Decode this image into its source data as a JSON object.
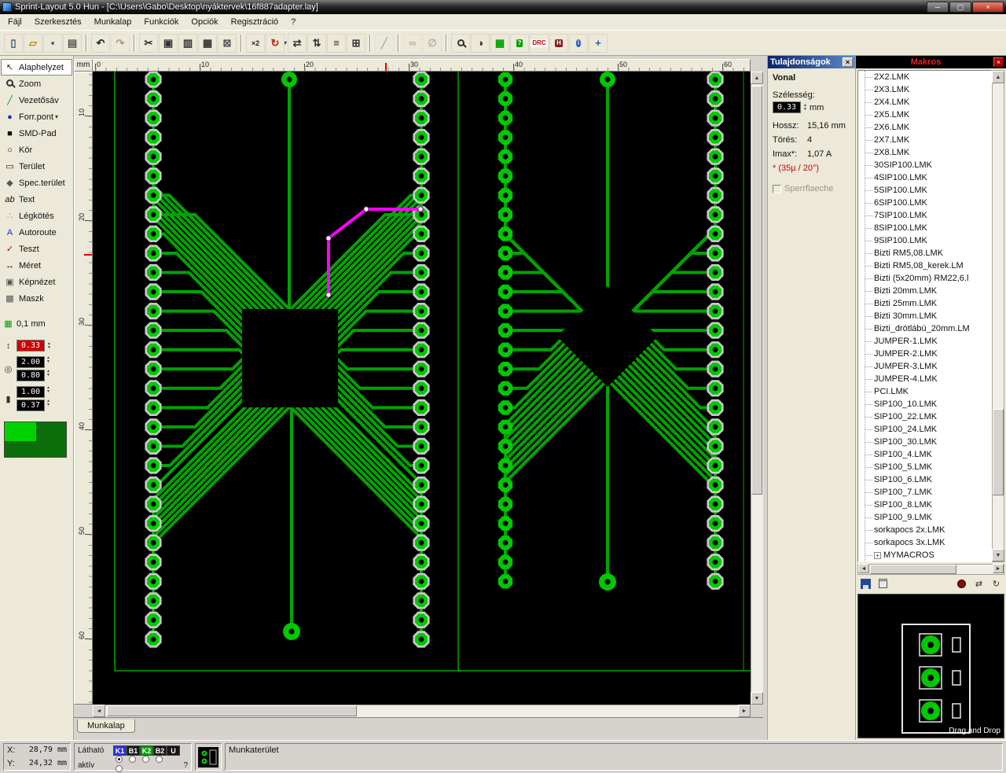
{
  "colors": {
    "trace": "#00a400",
    "pad": "#00c800",
    "silver": "#c8c8c8",
    "selection": "#ff00ff",
    "board_bg": "#000000",
    "value_red": "#cf0000",
    "macro_title_red": "#ee2222"
  },
  "titlebar": {
    "title": "Sprint-Layout 5.0 Hun      - [C:\\Users\\Gabo\\Desktop\\nyáktervek\\16f887adapter.lay]"
  },
  "menu": {
    "items": [
      "Fájl",
      "Szerkesztés",
      "Munkalap",
      "Funkciók",
      "Opciók",
      "Regisztráció",
      "?"
    ]
  },
  "toolbar": {
    "buttons": [
      {
        "name": "new"
      },
      {
        "name": "open"
      },
      {
        "name": "save"
      },
      {
        "name": "print"
      },
      {
        "sep": true
      },
      {
        "name": "undo"
      },
      {
        "name": "redo",
        "disabled": true
      },
      {
        "sep": true
      },
      {
        "name": "cut"
      },
      {
        "name": "copy"
      },
      {
        "name": "paste"
      },
      {
        "name": "duplicate"
      },
      {
        "name": "delete"
      },
      {
        "sep": true
      },
      {
        "name": "scale",
        "text": "×2"
      },
      {
        "name": "rotate",
        "dropdown": true
      },
      {
        "name": "mirror-horizontal"
      },
      {
        "name": "mirror-vertical"
      },
      {
        "name": "align"
      },
      {
        "name": "snap-grid"
      },
      {
        "sep": true
      },
      {
        "name": "solder-side",
        "disabled": true
      },
      {
        "sep": true
      },
      {
        "name": "link",
        "disabled": true
      },
      {
        "name": "unlink",
        "disabled": true
      },
      {
        "sep": true
      },
      {
        "name": "zoom"
      },
      {
        "name": "photo-view"
      },
      {
        "name": "layer-grid"
      },
      {
        "name": "test",
        "text": "?"
      },
      {
        "name": "drc",
        "text": "DRC"
      },
      {
        "name": "hpgl",
        "text": "H"
      },
      {
        "name": "info",
        "text": "i"
      },
      {
        "name": "capture"
      }
    ]
  },
  "tools": {
    "items": [
      {
        "label": "Alaphelyzet",
        "icon": "cursor",
        "active": true
      },
      {
        "label": "Zoom",
        "icon": "magnifier"
      },
      {
        "label": "Vezetősáv",
        "icon": "track"
      },
      {
        "label": "Forr.pont",
        "icon": "solder-pad",
        "dropdown": true
      },
      {
        "label": "SMD-Pad",
        "icon": "smd-pad"
      },
      {
        "label": "Kör",
        "icon": "circle"
      },
      {
        "label": "Terület",
        "icon": "area"
      },
      {
        "label": "Spec.terület",
        "icon": "special-area"
      },
      {
        "label": "Text",
        "icon": "text"
      },
      {
        "label": "Légkötés",
        "icon": "ratsnest"
      },
      {
        "label": "Autoroute",
        "icon": "autoroute"
      },
      {
        "label": "Teszt",
        "icon": "test-probe"
      },
      {
        "label": "Méret",
        "icon": "measure"
      },
      {
        "label": "Képnézet",
        "icon": "photo-view"
      },
      {
        "label": "Maszk",
        "icon": "mask"
      }
    ],
    "grid_label": "0,1 mm",
    "track_width": "0.33",
    "pad_diameter": "2.00",
    "pad_drill": "0.80",
    "smd_width": "1.00",
    "smd_height": "0.37"
  },
  "rulers": {
    "unit": "mm",
    "x_labels": [
      "0",
      "10",
      "20",
      "30",
      "40",
      "50",
      "60"
    ],
    "y_labels": [
      "10",
      "20",
      "30",
      "40",
      "50",
      "60"
    ]
  },
  "tab": {
    "label": "Munkalap"
  },
  "properties": {
    "title": "Tulajdonságok",
    "close": "×",
    "section_title": "Vonal",
    "width_label": "Szélesség:",
    "width_value": "0.33",
    "width_unit": "mm",
    "rows": [
      {
        "label": "Hossz:",
        "value": "15,16 mm"
      },
      {
        "label": "Törés:",
        "value": "4"
      },
      {
        "label": "Imax*:",
        "value": "1,07 A"
      }
    ],
    "footnote": "* (35µ / 20°)",
    "checkbox_label": "Sperrflaeche"
  },
  "macros": {
    "title": "Makros",
    "close": "×",
    "items": [
      "2X2.LMK",
      "2X3.LMK",
      "2X4.LMK",
      "2X5.LMK",
      "2X6.LMK",
      "2X7.LMK",
      "2X8.LMK",
      "30SIP100.LMK",
      "4SIP100.LMK",
      "5SIP100.LMK",
      "6SIP100.LMK",
      "7SIP100.LMK",
      "8SIP100.LMK",
      "9SIP100.LMK",
      "Bizti RM5,08.LMK",
      "Bizti RM5,08_kerek.LM",
      "Bizti (5x20mm) RM22,6.l",
      "Bizti 20mm.LMK",
      "Bizti 25mm.LMK",
      "Bizti 30mm.LMK",
      "Bizti_drótlábú_20mm.LM",
      "JUMPER-1.LMK",
      "JUMPER-2.LMK",
      "JUMPER-3.LMK",
      "JUMPER-4.LMK",
      "PCI.LMK",
      "SIP100_10.LMK",
      "SIP100_22.LMK",
      "SIP100_24.LMK",
      "SIP100_30.LMK",
      "SIP100_4.LMK",
      "SIP100_5.LMK",
      "SIP100_6.LMK",
      "SIP100_7.LMK",
      "SIP100_8.LMK",
      "SIP100_9.LMK",
      "sorkapocs 2x.LMK",
      "sorkapocs 3x.LMK"
    ],
    "group_item": "MYMACROS",
    "drag_hint": "Drag and Drop"
  },
  "status": {
    "x_label": "X:",
    "x_value": "28,79 mm",
    "y_label": "Y:",
    "y_value": "24,32 mm",
    "visible_label": "Látható",
    "active_label": "aktív",
    "layers": [
      {
        "label": "K1",
        "color": "#2e2ee0"
      },
      {
        "label": "B1",
        "color": "#151515"
      },
      {
        "label": "K2",
        "color": "#00a000"
      },
      {
        "label": "B2",
        "color": "#151515"
      },
      {
        "label": "U",
        "color": "#151515"
      }
    ],
    "help_label": "?",
    "workspace_label": "Munkaterület"
  }
}
